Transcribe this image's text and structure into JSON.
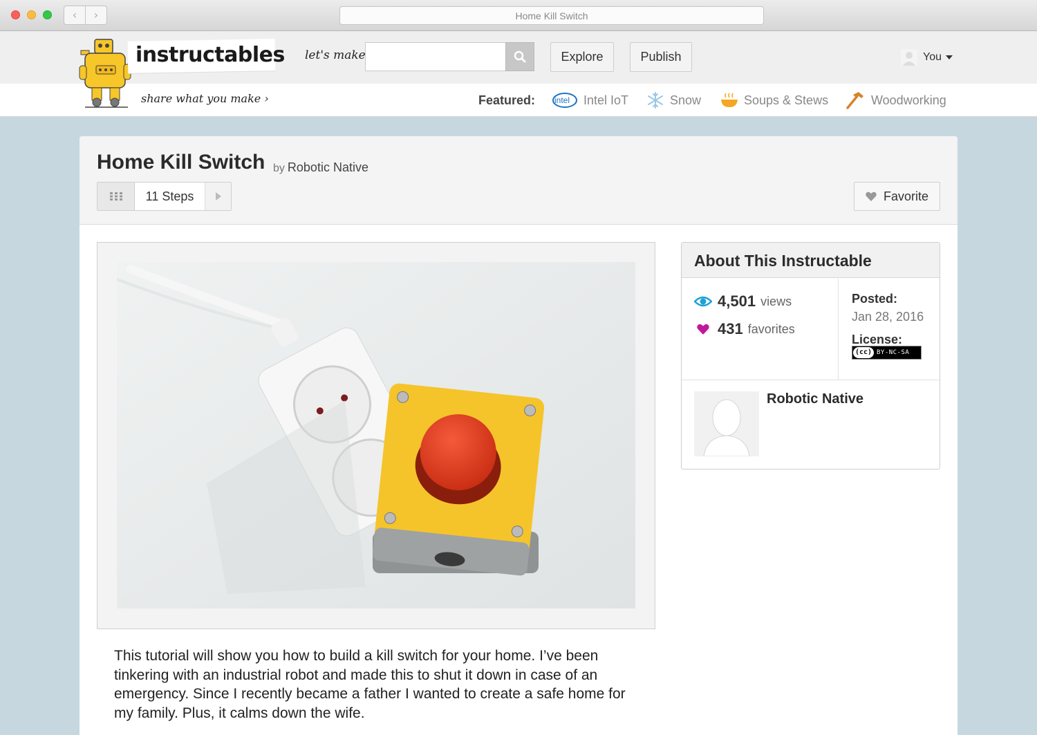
{
  "browser": {
    "url_title": "Home Kill Switch",
    "back": "‹",
    "forward": "›"
  },
  "header": {
    "logo": "instructables",
    "tagline": "share what you make ›",
    "lets_make": "let's make",
    "search_placeholder": "",
    "explore": "Explore",
    "publish": "Publish",
    "user": "You"
  },
  "featured": {
    "label": "Featured:",
    "items": [
      {
        "label": "Intel IoT",
        "icon": "intel-logo-icon"
      },
      {
        "label": "Snow",
        "icon": "snowflake-icon"
      },
      {
        "label": "Soups & Stews",
        "icon": "soup-bowl-icon"
      },
      {
        "label": "Woodworking",
        "icon": "hammer-icon"
      }
    ],
    "intel_logo_text": "intel"
  },
  "project": {
    "title": "Home Kill Switch",
    "by": "by",
    "author": "Robotic Native",
    "steps": "11 Steps",
    "favorite": "Favorite",
    "intro": "This tutorial will show you how to build a kill switch for your home. I’ve been tinkering with an industrial robot and made this to shut it down in case of an emergency. Since I recently became a father I wanted to create a safe home for my family. Plus, it calms down the wife."
  },
  "about": {
    "title": "About This Instructable",
    "views_count": "4,501",
    "views_label": "views",
    "favorites_count": "431",
    "favorites_label": "favorites",
    "posted_label": "Posted:",
    "posted_date": "Jan 28, 2016",
    "license_label": "License:",
    "license_cc": "(cc)",
    "license_type": "BY-NC-SA",
    "author_name": "Robotic Native"
  },
  "colors": {
    "page_bg": "#c6d7e0",
    "views_icon": "#1fa1d8",
    "favorites_icon": "#c01a9a",
    "robot_yellow": "#f7c628",
    "button_red": "#e0381c"
  }
}
